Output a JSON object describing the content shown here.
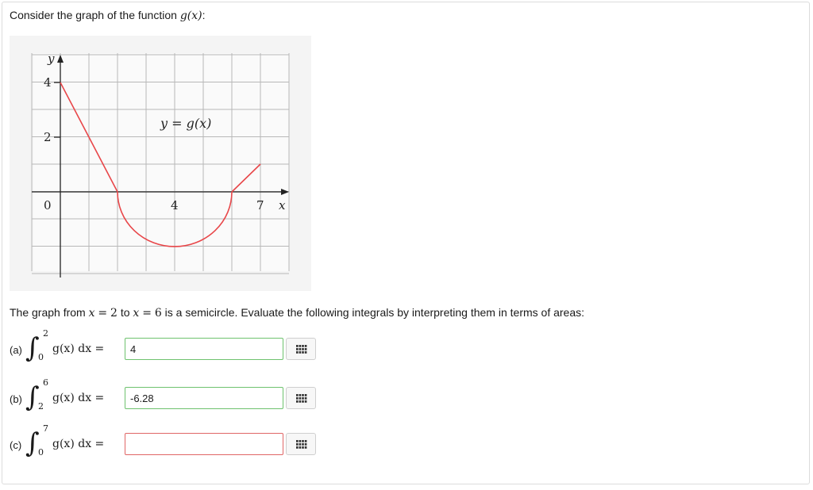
{
  "question": {
    "intro_text": "Consider the graph of the function",
    "intro_func": "g(x)",
    "intro_colon": ":",
    "description": {
      "t1": "The graph from",
      "m1": "x",
      "eq1": "=",
      "v1": "2",
      "t2": "to",
      "m2": "x",
      "eq2": "=",
      "v2": "6",
      "t3": "is a semicircle. Evaluate the following integrals by interpreting them in terms of areas:"
    }
  },
  "graph": {
    "y_axis_label": "y",
    "x_axis_label": "x",
    "function_label": "y = g(x)",
    "y_tick_labels": [
      "4",
      "2"
    ],
    "x_tick_labels": [
      "0",
      "4",
      "7"
    ],
    "line_color": "#e8474a",
    "grid_color": "#b8b8b8"
  },
  "parts": [
    {
      "label": "(a)",
      "lower": "0",
      "upper": "2",
      "integrand": "g(x) dx =",
      "value": "4",
      "status": "correct"
    },
    {
      "label": "(b)",
      "lower": "2",
      "upper": "6",
      "integrand": "g(x) dx =",
      "value": "-6.28",
      "status": "correct"
    },
    {
      "label": "(c)",
      "lower": "0",
      "upper": "7",
      "integrand": "g(x) dx =",
      "value": "",
      "status": "incorrect"
    }
  ],
  "colors": {
    "correct_border": "#6ec26e",
    "incorrect_border": "#e06666"
  }
}
